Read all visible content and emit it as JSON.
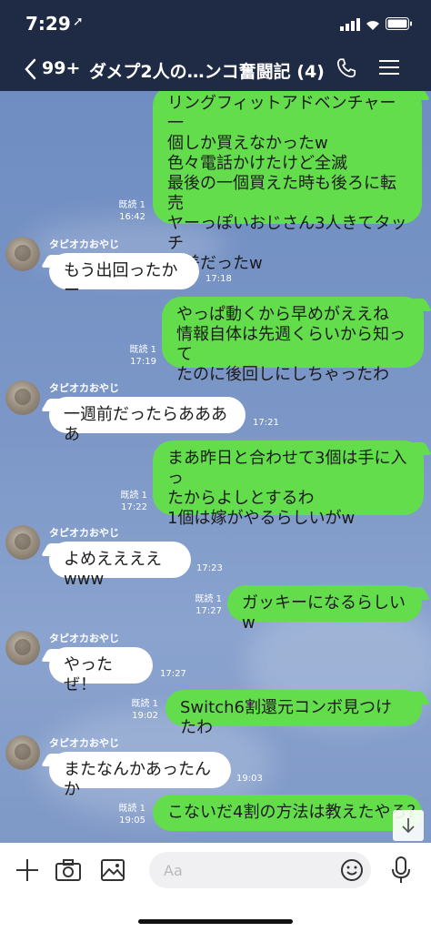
{
  "status": {
    "time": "7:29"
  },
  "header": {
    "back_count": "99+",
    "title": "ダメプ2人の…ンコ奮闘記 (4)"
  },
  "messages": [
    {
      "side": "right",
      "text": "リングフィットアドベンチャー一\n個しか買えなかったw\n色々電話かけたけど全滅\n最後の一個買えた時も後ろに転売\nヤーっぽいおじさん3人きてタッチ\nの差だったw",
      "read": "既読 1",
      "time": "16:42"
    },
    {
      "side": "left",
      "sender": "タピオカおやじ",
      "text": "もう出回ったかー",
      "time": "17:18"
    },
    {
      "side": "right",
      "text": "やっぱ動くから早めがええね\n情報自体は先週くらいから知って\nたのに後回しにしちゃったわ",
      "read": "既読 1",
      "time": "17:19"
    },
    {
      "side": "left",
      "sender": "タピオカおやじ",
      "text": "一週前だったらああああ",
      "time": "17:21"
    },
    {
      "side": "right",
      "text": "まあ昨日と合わせて3個は手に入っ\nたからよしとするわ\n1個は嫁がやるらしいがw",
      "read": "既読 1",
      "time": "17:22"
    },
    {
      "side": "left",
      "sender": "タピオカおやじ",
      "text": "よめええええwww",
      "time": "17:23"
    },
    {
      "side": "right",
      "text": "ガッキーになるらしいw",
      "read": "既読 1",
      "time": "17:27"
    },
    {
      "side": "left",
      "sender": "タピオカおやじ",
      "text": "やったぜ！",
      "time": "17:27"
    },
    {
      "side": "right",
      "text": "Switch6割還元コンボ見つけたわ",
      "read": "既読 1",
      "time": "19:02"
    },
    {
      "side": "left",
      "sender": "タピオカおやじ",
      "text": "またなんかあったんか",
      "time": "19:03"
    },
    {
      "side": "right",
      "text": "こないだ4割の方法は教えたやろ？",
      "read": "既読 1",
      "time": "19:05"
    }
  ],
  "input": {
    "placeholder": "Aa"
  },
  "icons": [
    "back-chevron-icon",
    "phone-icon",
    "menu-icon",
    "plus-icon",
    "camera-icon",
    "image-icon",
    "emoji-icon",
    "mic-icon",
    "scroll-down-icon"
  ],
  "colors": {
    "green_bubble": "#63dd4c",
    "header_bg": "#1f2b45"
  }
}
